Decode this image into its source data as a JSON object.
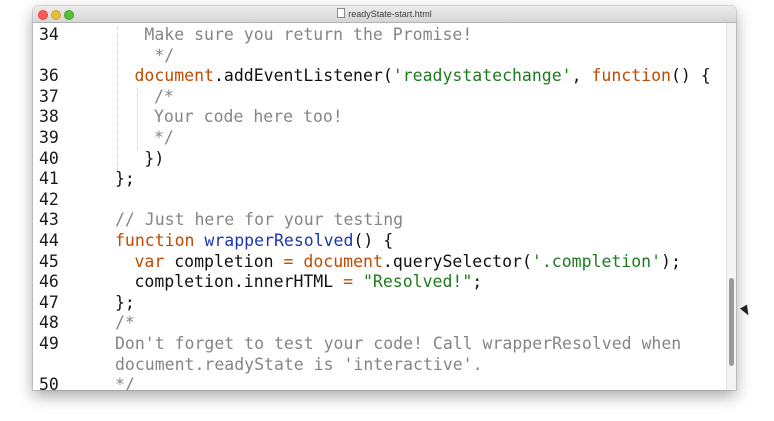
{
  "window": {
    "title": "readyState-start.html"
  },
  "editor": {
    "lines": [
      {
        "num": "34",
        "indent": 1,
        "tokens": [
          {
            "t": " Make sure you return the Promise!",
            "c": "cm"
          }
        ]
      },
      {
        "num": "",
        "indent": 1,
        "tokens": [
          {
            "t": "  */",
            "c": "cm"
          }
        ]
      },
      {
        "num": "36",
        "indent": 1,
        "tokens": [
          {
            "t": "document",
            "c": "kw"
          },
          {
            "t": ".addEventListener(",
            "c": ""
          },
          {
            "t": "'readystatechange'",
            "c": "str"
          },
          {
            "t": ", ",
            "c": ""
          },
          {
            "t": "function",
            "c": "kw"
          },
          {
            "t": "() {",
            "c": ""
          }
        ]
      },
      {
        "num": "37",
        "indent": 2,
        "tokens": [
          {
            "t": "/*",
            "c": "cm"
          }
        ]
      },
      {
        "num": "38",
        "indent": 2,
        "tokens": [
          {
            "t": "Your code here too!",
            "c": "cm"
          }
        ]
      },
      {
        "num": "39",
        "indent": 2,
        "tokens": [
          {
            "t": "*/",
            "c": "cm"
          }
        ]
      },
      {
        "num": "40",
        "indent": 1,
        "tokens": [
          {
            "t": " })",
            "c": ""
          }
        ]
      },
      {
        "num": "41",
        "indent": 0,
        "tokens": [
          {
            "t": "};",
            "c": ""
          }
        ]
      },
      {
        "num": "42",
        "indent": 0,
        "tokens": []
      },
      {
        "num": "43",
        "indent": 0,
        "tokens": [
          {
            "t": "// Just here for your testing",
            "c": "cm"
          }
        ]
      },
      {
        "num": "44",
        "indent": 0,
        "tokens": [
          {
            "t": "function",
            "c": "kw"
          },
          {
            "t": " ",
            "c": ""
          },
          {
            "t": "wrapperResolved",
            "c": "fn"
          },
          {
            "t": "() {",
            "c": ""
          }
        ]
      },
      {
        "num": "45",
        "indent": 1,
        "tokens": [
          {
            "t": "var",
            "c": "kw"
          },
          {
            "t": " completion ",
            "c": ""
          },
          {
            "t": "=",
            "c": "op"
          },
          {
            "t": " ",
            "c": ""
          },
          {
            "t": "document",
            "c": "kw"
          },
          {
            "t": ".querySelector(",
            "c": ""
          },
          {
            "t": "'.completion'",
            "c": "str"
          },
          {
            "t": ");",
            "c": ""
          }
        ]
      },
      {
        "num": "46",
        "indent": 1,
        "tokens": [
          {
            "t": "completion.innerHTML ",
            "c": ""
          },
          {
            "t": "=",
            "c": "op"
          },
          {
            "t": " ",
            "c": ""
          },
          {
            "t": "\"Resolved!\"",
            "c": "str"
          },
          {
            "t": ";",
            "c": ""
          }
        ]
      },
      {
        "num": "47",
        "indent": 0,
        "tokens": [
          {
            "t": "};",
            "c": ""
          }
        ]
      },
      {
        "num": "48",
        "indent": 0,
        "tokens": [
          {
            "t": "/*",
            "c": "cm"
          }
        ]
      },
      {
        "num": "49",
        "indent": 0,
        "tokens": [
          {
            "t": "Don't forget to test your code! Call wrapperResolved when",
            "c": "cm"
          }
        ]
      },
      {
        "num": "",
        "indent": 0,
        "tokens": [
          {
            "t": "document.readyState is 'interactive'.",
            "c": "cm"
          }
        ]
      },
      {
        "num": "50",
        "indent": 0,
        "tokens": [
          {
            "t": "*/",
            "c": "cm"
          }
        ]
      }
    ]
  },
  "colors": {
    "keyword": "#c04a00",
    "function_name": "#1a36b5",
    "string": "#1d7a1d",
    "comment": "#858585"
  }
}
